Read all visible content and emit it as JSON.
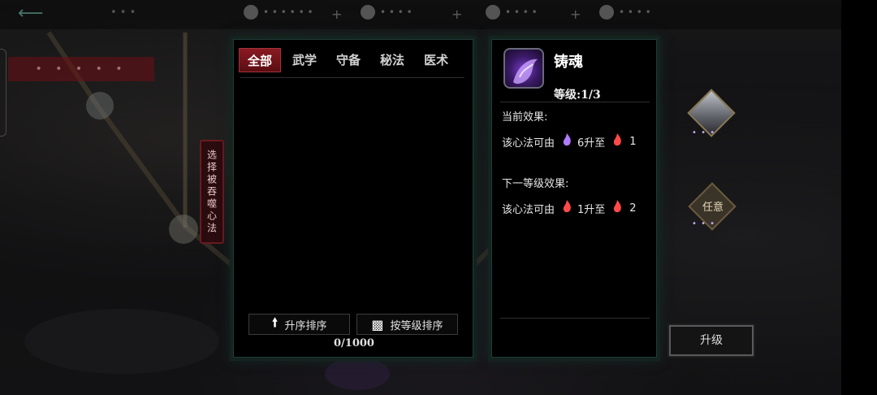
{
  "top": {
    "back_icon": "back-arrow-icon",
    "left_label": "• • •",
    "res1": "• • • • • •",
    "res2": "• • • •",
    "res3": "• • • •",
    "res4": "• • • •"
  },
  "side_tag": "选择被吞噬心法",
  "tabs": [
    "全部",
    "武学",
    "守备",
    "秘法",
    "医术"
  ],
  "sort": {
    "asc_label": "升序排序",
    "level_label": "按等级排序",
    "count": "0/1000"
  },
  "detail": {
    "name": "铸魂",
    "level": "等级:1/3",
    "current_title": "当前效果:",
    "current_prefix": "该心法可由",
    "current_from": "6升至",
    "current_to": "1",
    "next_title": "下一等级效果:",
    "next_prefix": "该心法可由",
    "next_from": "1升至",
    "next_to": "2"
  },
  "nodes": {
    "any_label": "任意",
    "dots": "• • •"
  },
  "upgrade_label": "升级",
  "colors": {
    "tab_active": "#8a1a22",
    "flame_purple": "#b07bff",
    "flame_red": "#ff4a4a"
  }
}
